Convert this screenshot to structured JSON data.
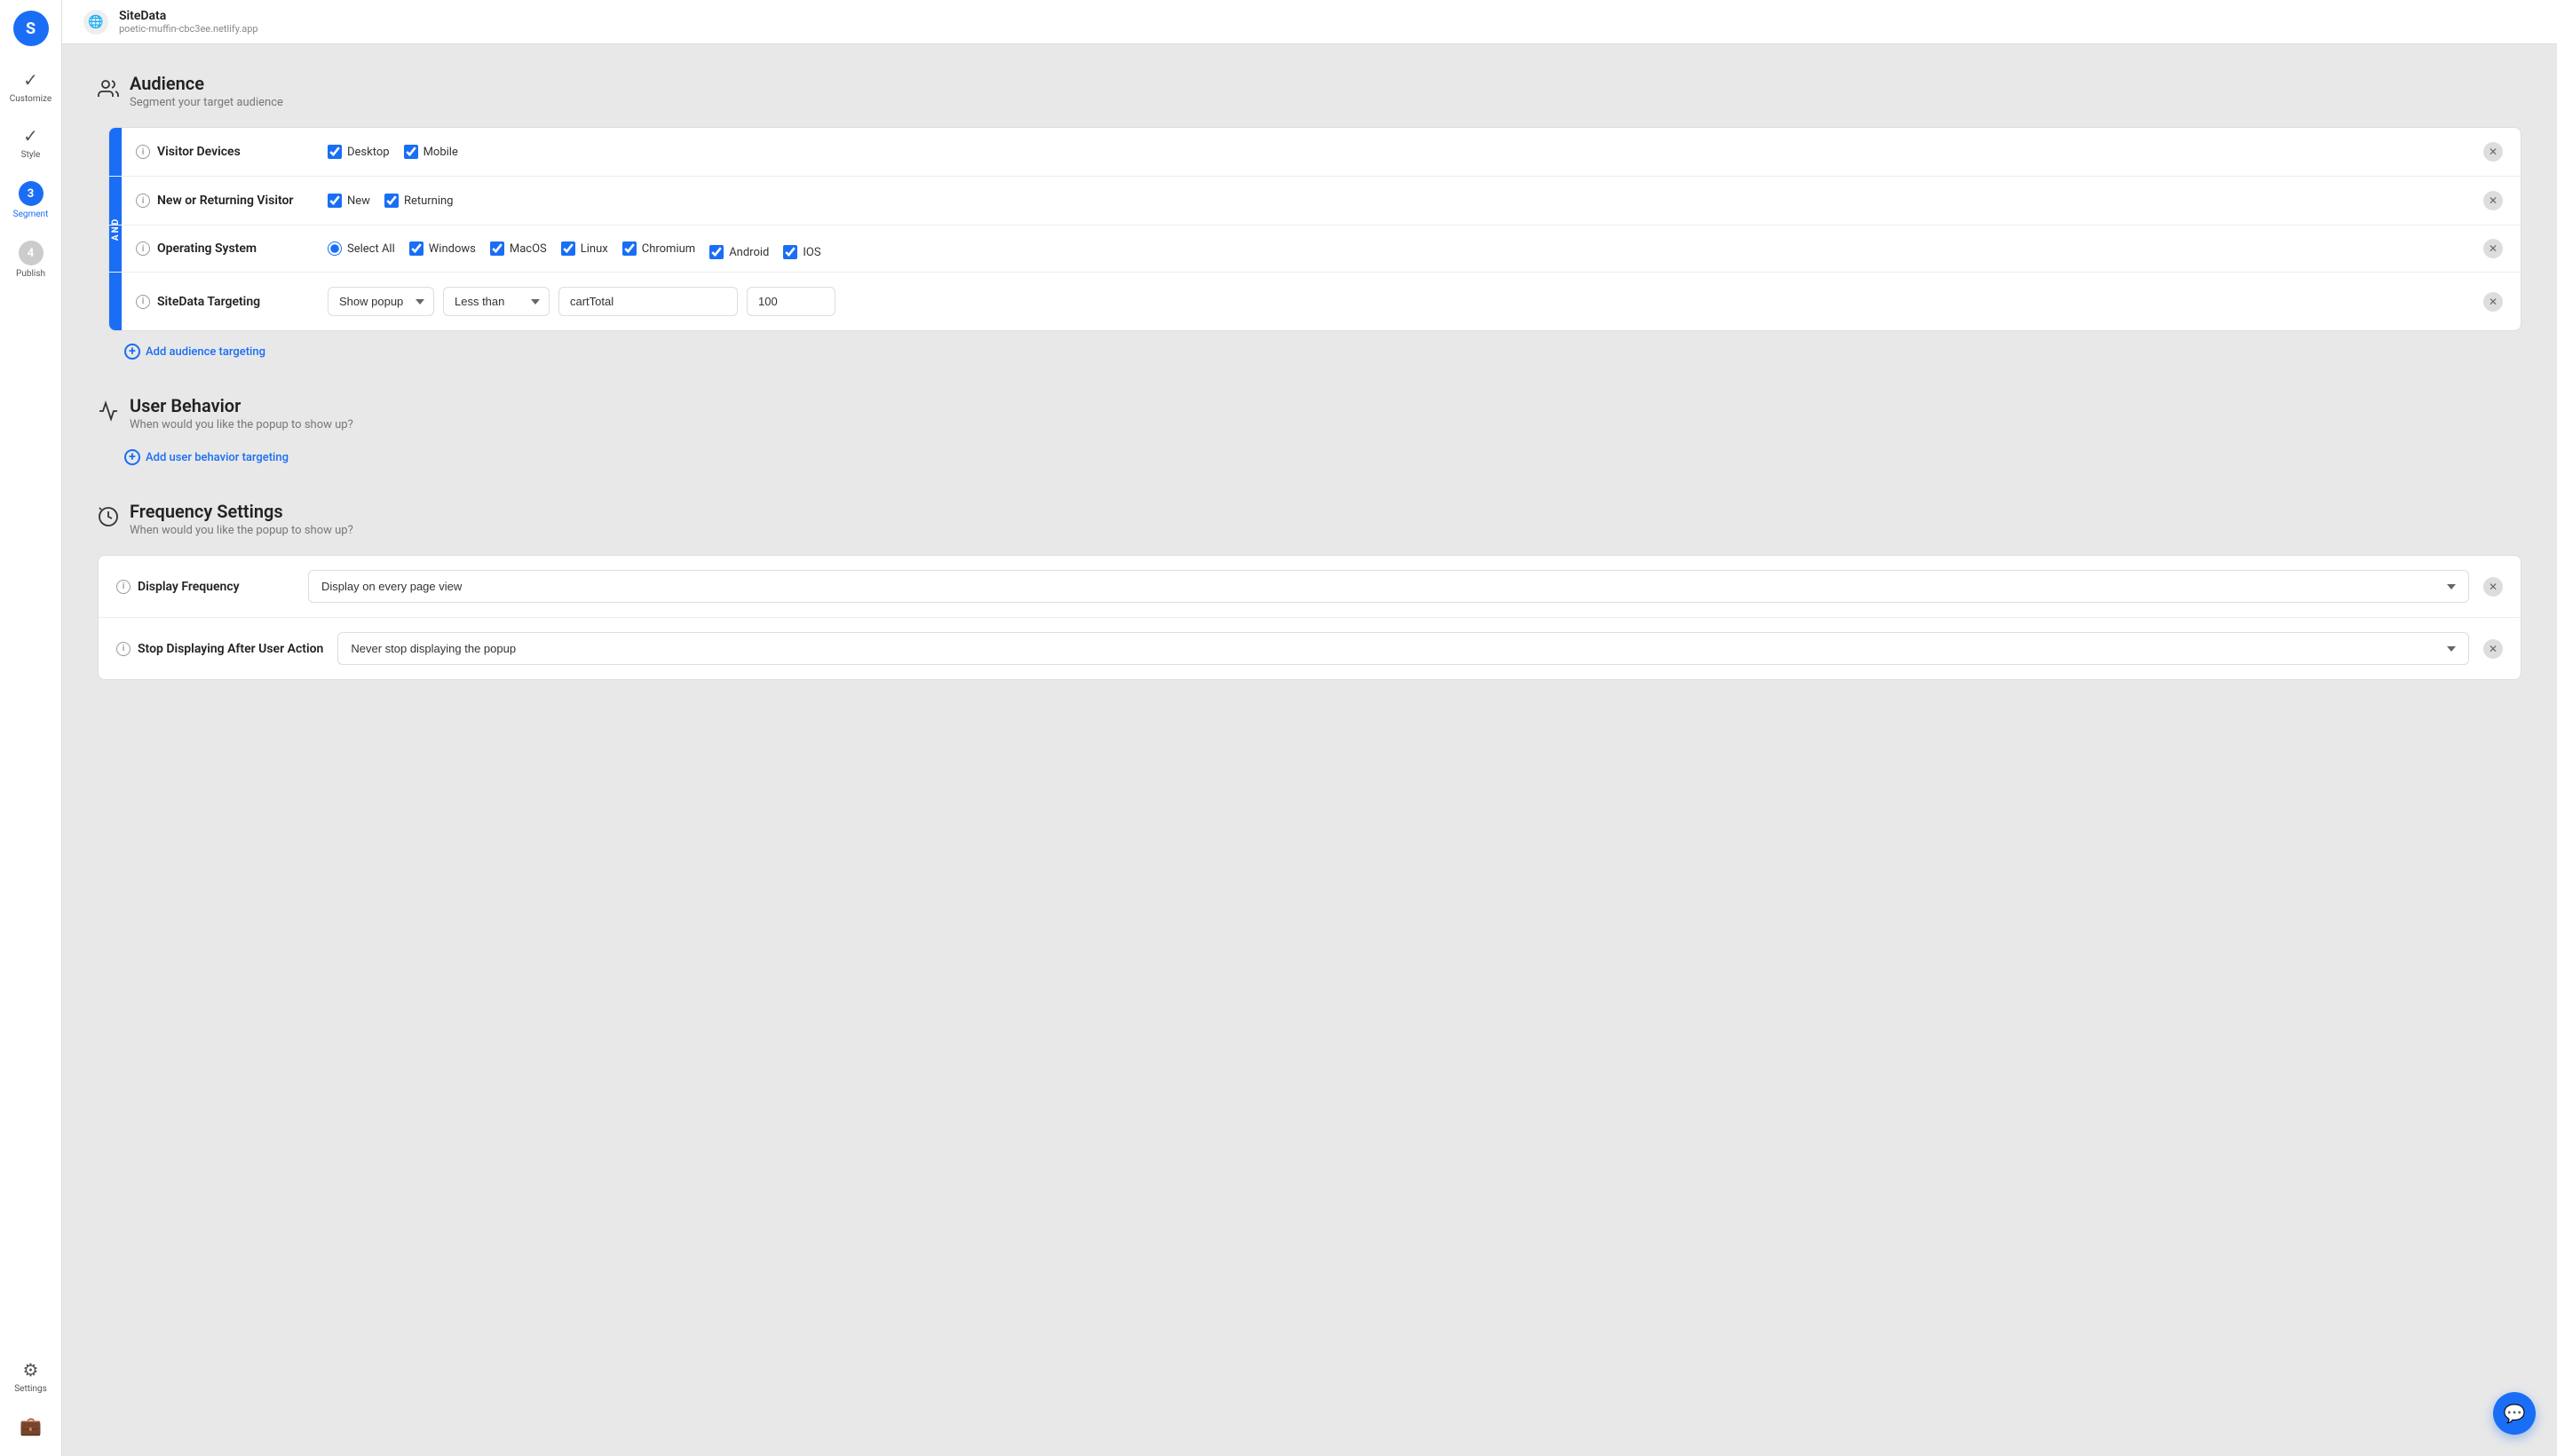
{
  "app": {
    "logo_text": "S",
    "site_name": "SiteData",
    "site_url": "poetic-muffin-cbc3ee.netlify.app"
  },
  "sidebar": {
    "items": [
      {
        "id": "customize",
        "label": "Customize",
        "icon": "✓",
        "type": "check"
      },
      {
        "id": "style",
        "label": "Style",
        "icon": "✓",
        "type": "check"
      },
      {
        "id": "segment",
        "label": "Segment",
        "number": "3",
        "type": "numbered",
        "active": true
      },
      {
        "id": "publish",
        "label": "Publish",
        "number": "4",
        "type": "numbered-gray"
      },
      {
        "id": "settings",
        "label": "Settings",
        "icon": "⚙",
        "type": "icon"
      },
      {
        "id": "briefcase",
        "label": "",
        "icon": "💼",
        "type": "icon"
      }
    ]
  },
  "audience_section": {
    "title": "Audience",
    "subtitle": "Segment your target audience",
    "and_label": "AND",
    "rows": [
      {
        "id": "visitor-devices",
        "label": "Visitor Devices",
        "type": "checkboxes",
        "options": [
          {
            "id": "desktop",
            "label": "Desktop",
            "checked": true
          },
          {
            "id": "mobile",
            "label": "Mobile",
            "checked": true
          }
        ]
      },
      {
        "id": "new-returning",
        "label": "New or Returning Visitor",
        "type": "checkboxes",
        "options": [
          {
            "id": "new",
            "label": "New",
            "checked": true
          },
          {
            "id": "returning",
            "label": "Returning",
            "checked": true
          }
        ]
      },
      {
        "id": "operating-system",
        "label": "Operating System",
        "type": "os",
        "options": [
          {
            "id": "select-all",
            "label": "Select All",
            "type": "radio",
            "checked": true
          },
          {
            "id": "windows",
            "label": "Windows",
            "checked": true
          },
          {
            "id": "macos",
            "label": "MacOS",
            "checked": true
          },
          {
            "id": "linux",
            "label": "Linux",
            "checked": true
          },
          {
            "id": "chromium",
            "label": "Chromium",
            "checked": true
          },
          {
            "id": "android",
            "label": "Android",
            "checked": true
          },
          {
            "id": "ios",
            "label": "IOS",
            "checked": true
          }
        ]
      },
      {
        "id": "sitedata-targeting",
        "label": "SiteData Targeting",
        "type": "sitedata",
        "show_popup_label": "Show popup",
        "condition_label": "Less than",
        "field_value": "cartTotal",
        "number_value": "100"
      }
    ],
    "add_targeting_label": "Add audience targeting"
  },
  "user_behavior_section": {
    "title": "User Behavior",
    "subtitle": "When would you like the popup to show up?",
    "add_behavior_label": "Add user behavior targeting"
  },
  "frequency_section": {
    "title": "Frequency Settings",
    "subtitle": "When would you like the popup to show up?",
    "rows": [
      {
        "id": "display-frequency",
        "label": "Display Frequency",
        "value": "Display on every page view"
      },
      {
        "id": "stop-displaying",
        "label": "Stop Displaying After User Action",
        "value": "Never stop displaying the popup"
      }
    ]
  },
  "chat_button": {
    "icon": "💬"
  }
}
